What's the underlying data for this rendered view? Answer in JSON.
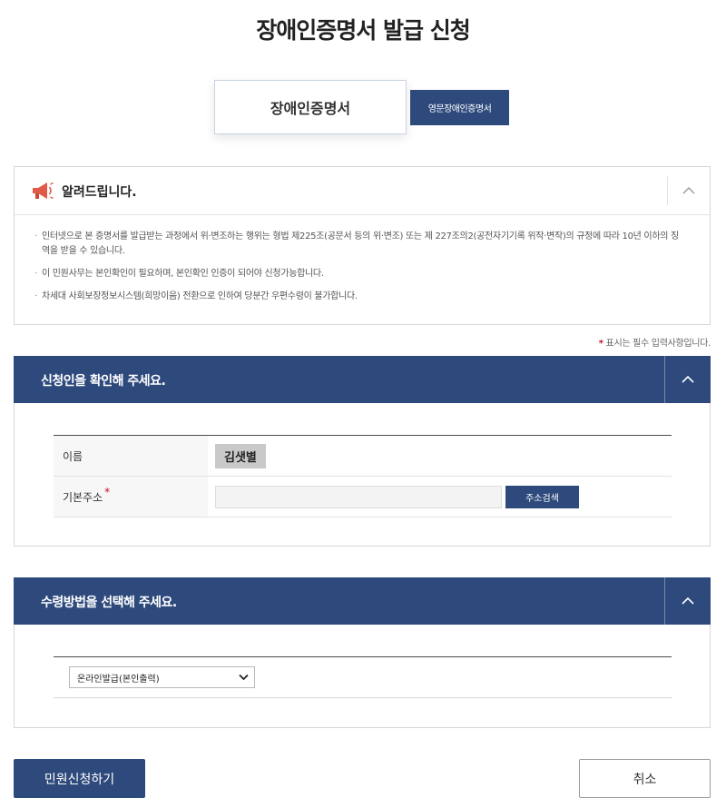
{
  "page": {
    "title": "장애인증명서 발급 신청"
  },
  "tabs": {
    "main_label": "장애인증명서",
    "english_label": "영문장애인증명서"
  },
  "notice": {
    "title": "알려드립니다.",
    "items": [
      "인터넷으로 본 증명서를 발급받는 과정에서 위·변조하는 행위는 형법 제225조(공문서 등의 위·변조) 또는 제 227조의2(공전자기기록 위작·변작)의 규정에 따라 10년 이하의 징역을 받을 수 있습니다.",
      "이 민원사무는 본인확인이 필요하며, 본인확인 인증이 되어야 신청가능합니다.",
      "차세대 사회보장정보시스템(희망이음) 전환으로 인하여 당분간 우편수령이 불가합니다."
    ]
  },
  "required_note": {
    "star": "*",
    "text": " 표시는 필수 입력사항입니다."
  },
  "applicant_section": {
    "title": "신청인을 확인해 주세요.",
    "name_label": "이름",
    "name_value": "김샛별",
    "address_label": "기본주소",
    "address_star": "*",
    "address_value": "",
    "address_button": "주소검색"
  },
  "receipt_section": {
    "title": "수령방법을 선택해 주세요.",
    "selected_method": "온라인발급(본인출력)"
  },
  "actions": {
    "apply_label": "민원신청하기",
    "cancel_label": "취소"
  },
  "colors": {
    "primary": "#2e4a7d",
    "required": "#c8102e",
    "megaphone": "#e05a47"
  },
  "icons": {
    "notice": "megaphone-icon",
    "collapse": "chevron-up-icon",
    "select": "chevron-down-icon"
  }
}
